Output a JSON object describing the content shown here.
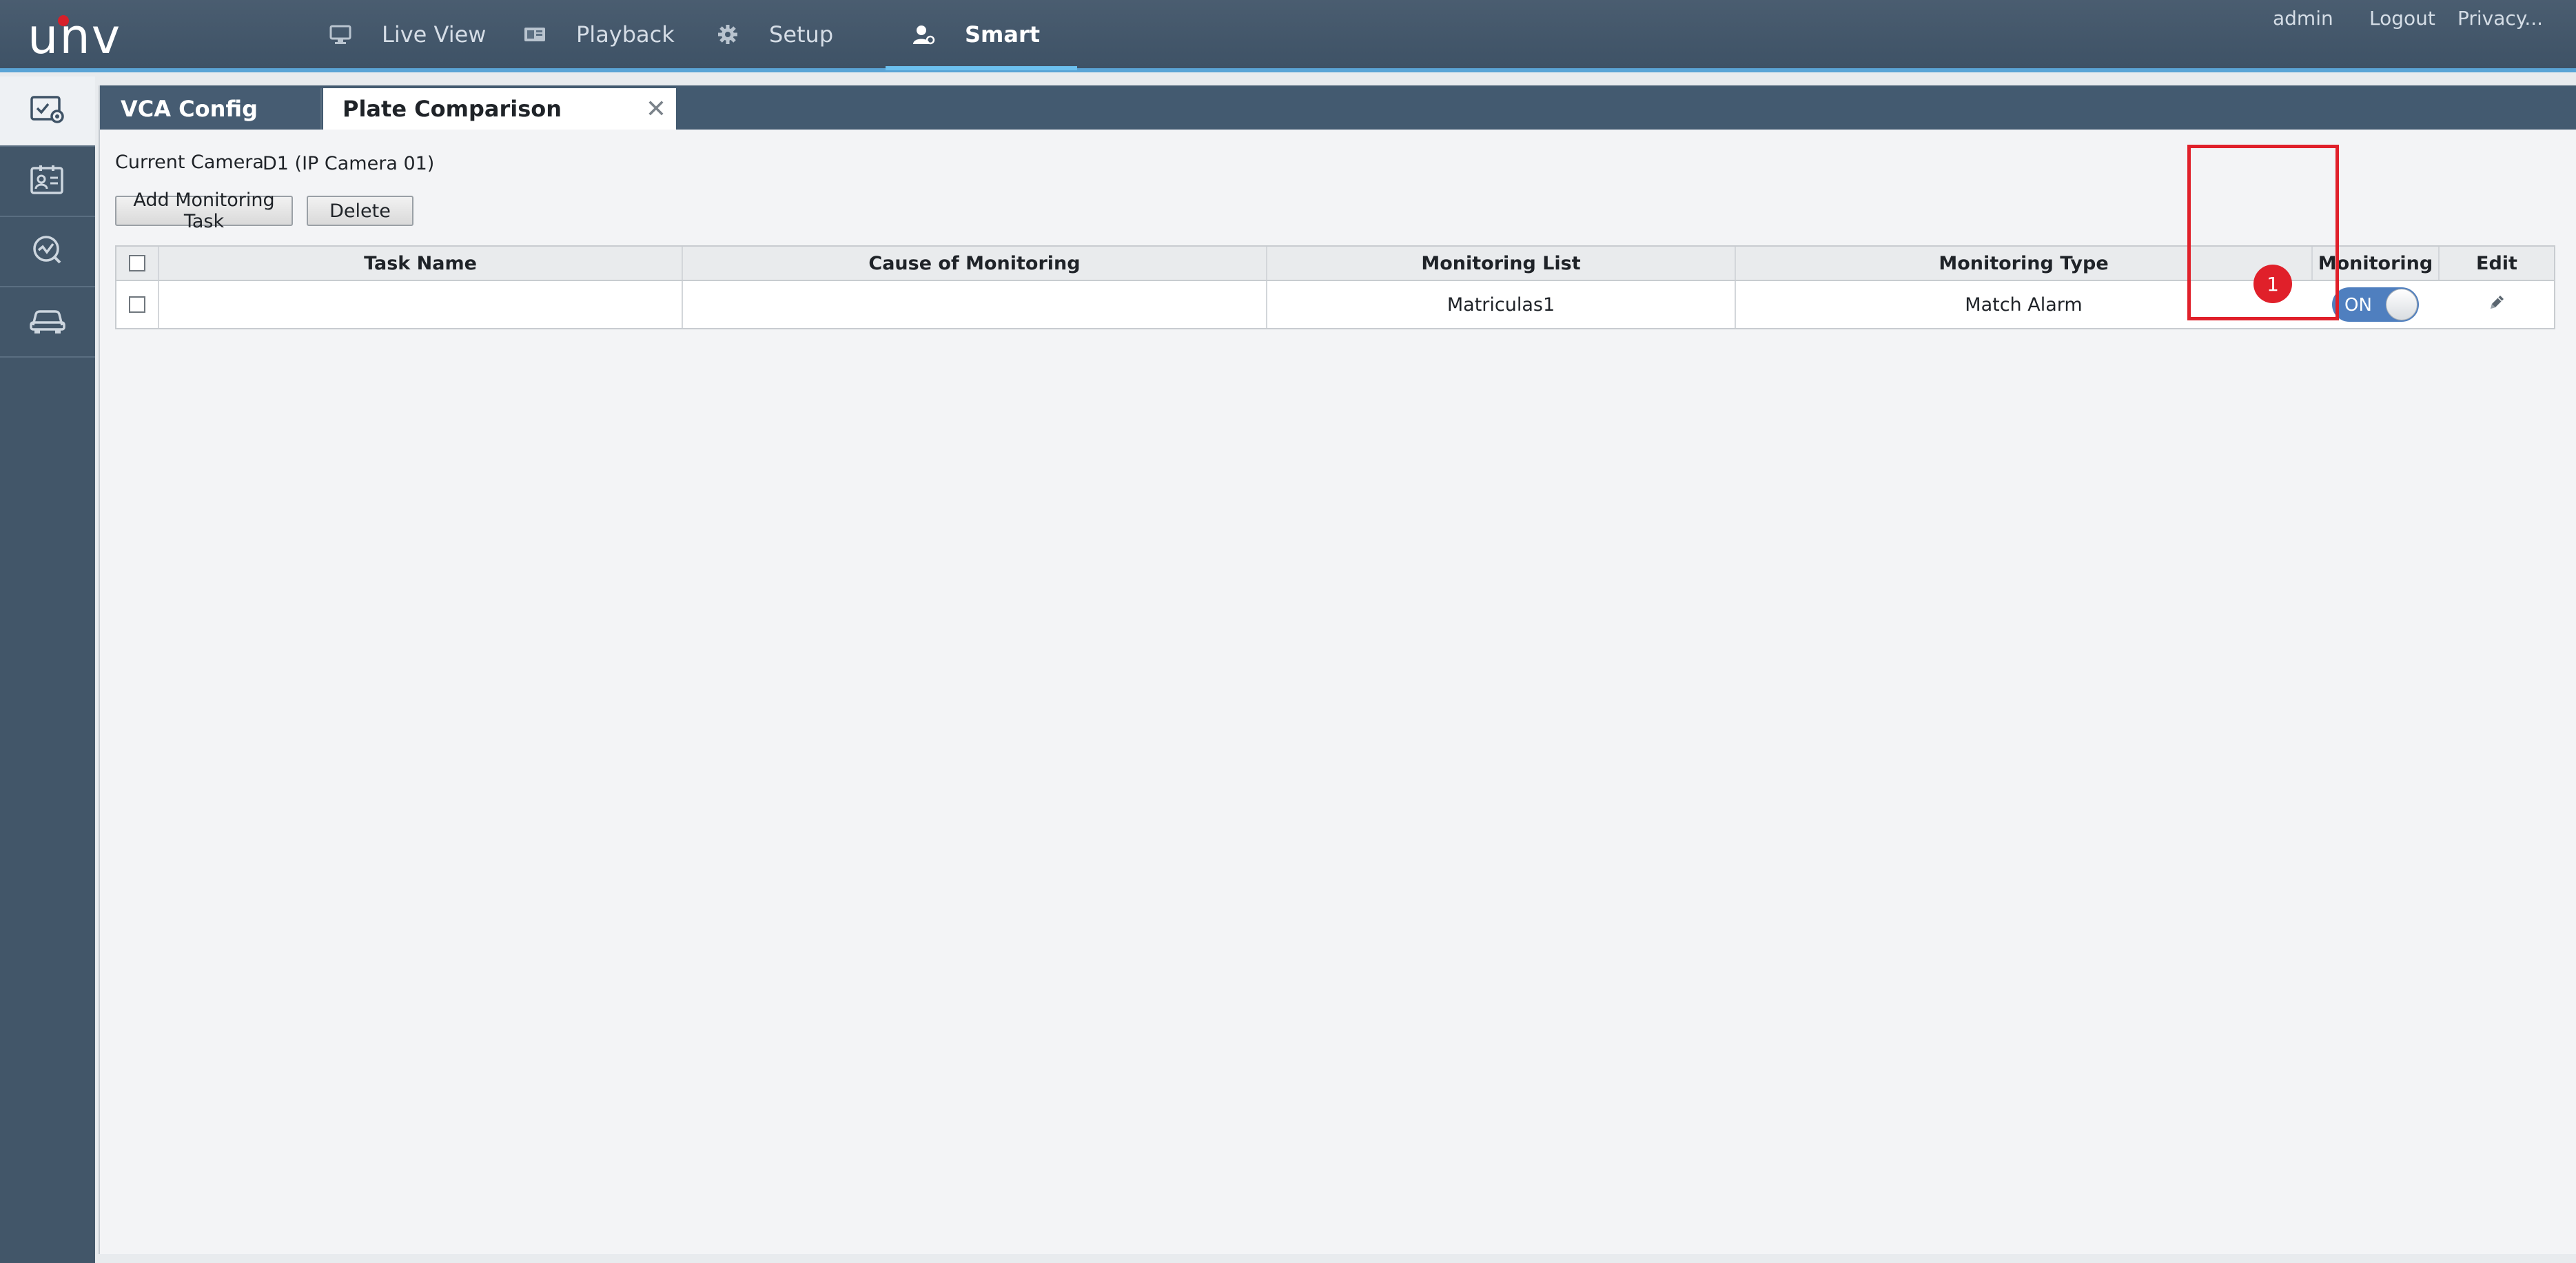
{
  "app": {
    "logo_text": "unv"
  },
  "nav": {
    "items": [
      {
        "label": "Live View",
        "icon": "monitor-icon"
      },
      {
        "label": "Playback",
        "icon": "playback-icon"
      },
      {
        "label": "Setup",
        "icon": "gear-icon"
      },
      {
        "label": "Smart",
        "icon": "smart-user-icon",
        "active": true
      }
    ]
  },
  "top_right": {
    "user": "admin",
    "logout": "Logout",
    "privacy": "Privacy..."
  },
  "sidebar": {
    "items": [
      {
        "icon": "vca-config-icon",
        "active": true
      },
      {
        "icon": "id-card-icon"
      },
      {
        "icon": "analytics-check-icon"
      },
      {
        "icon": "vehicle-icon"
      }
    ]
  },
  "tabs": [
    {
      "label": "VCA Config"
    },
    {
      "label": "Plate Comparison",
      "closable": true
    }
  ],
  "camera": {
    "label": "Current Camera",
    "value": "D1 (IP Camera 01)"
  },
  "toolbar": {
    "add_label": "Add Monitoring Task",
    "delete_label": "Delete"
  },
  "table": {
    "headers": {
      "task_name": "Task Name",
      "cause": "Cause of Monitoring",
      "list": "Monitoring List",
      "type": "Monitoring Type",
      "monitoring": "Monitoring",
      "edit": "Edit"
    },
    "rows": [
      {
        "task_name": "",
        "cause": "",
        "list": "Matriculas1",
        "type": "Match Alarm",
        "monitoring": "ON"
      }
    ]
  },
  "annotation": {
    "badge": "1",
    "color": "#e0202a"
  },
  "colors": {
    "topbar": "#3e5266",
    "accent": "#6cc0ef",
    "toggle_on": "#4f7fbf"
  }
}
